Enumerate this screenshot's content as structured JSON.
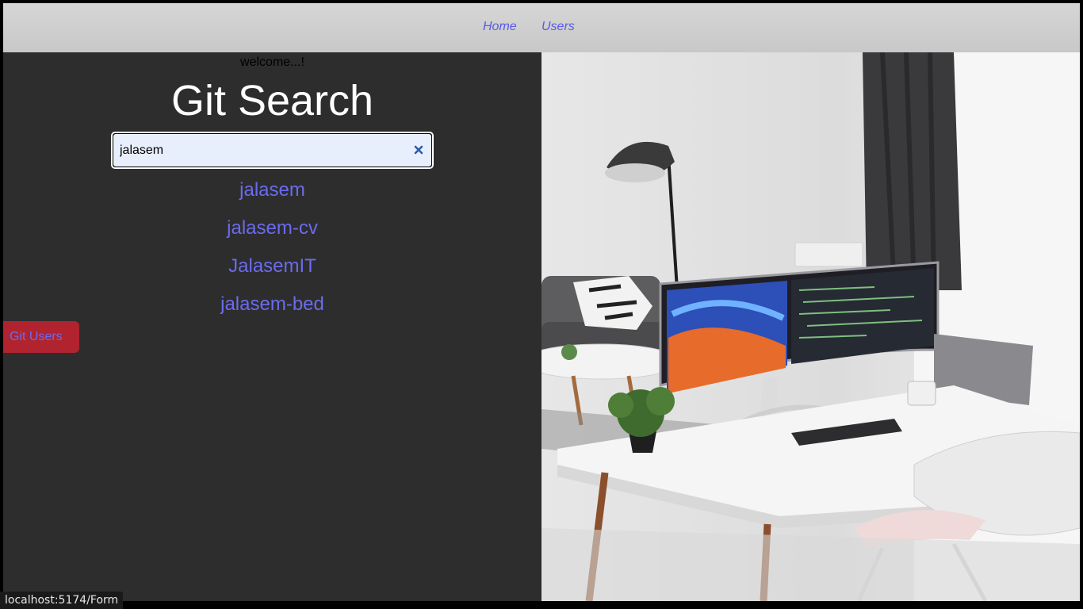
{
  "nav": {
    "home": "Home",
    "users": "Users"
  },
  "main": {
    "welcome": "welcome...!",
    "title": "Git Search",
    "search": {
      "value": "jalasem",
      "clear_icon": "close-icon"
    },
    "results": [
      "jalasem",
      "jalasem-cv",
      "JalasemIT",
      "jalasem-bed"
    ],
    "git_users_button": "Git Users"
  },
  "hero_image": {
    "subject": "workspace-photo"
  },
  "status_bar": {
    "url": "localhost:5174/Form"
  },
  "colors": {
    "link": "#6b6bf0",
    "left_panel_bg": "#2d2d2d",
    "navbar_bg": "#cfcfcf",
    "button_bg": "#b0232f",
    "input_bg": "#e8effc"
  }
}
